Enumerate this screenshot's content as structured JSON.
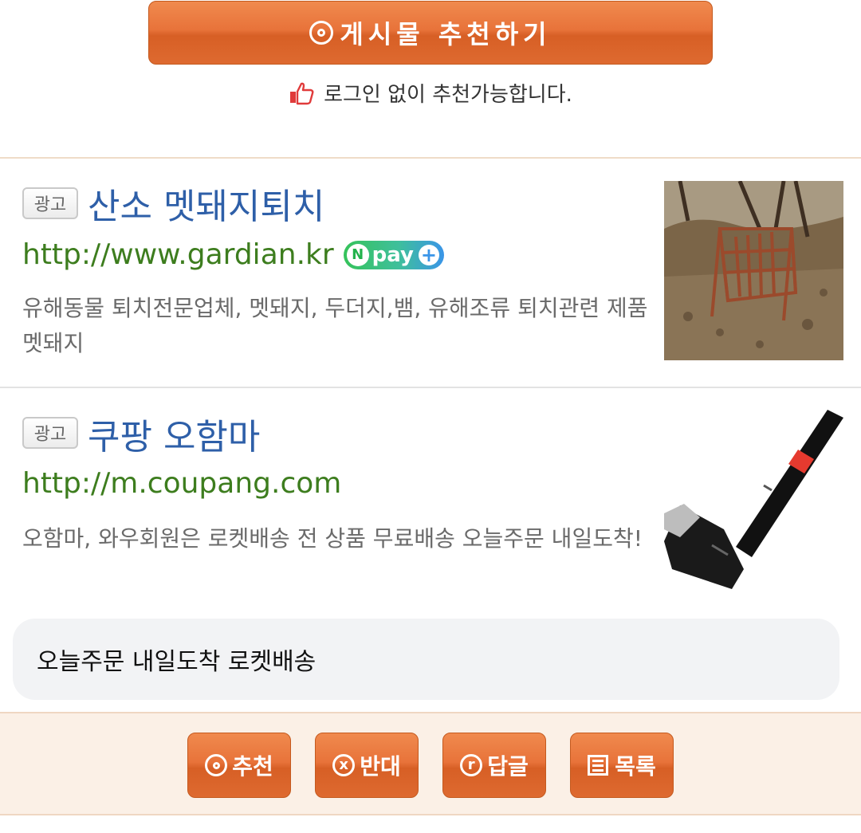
{
  "recommend": {
    "button_label": "게시물 추천하기",
    "note": "로그인 없이 추천가능합니다."
  },
  "ads": [
    {
      "badge": "광고",
      "title": "산소 멧돼지퇴치",
      "url": "http://www.gardian.kr",
      "npay": "pay",
      "description": "유해동물 퇴치전문업체, 멧돼지, 두더지,뱀, 유해조류 퇴치관련 제품 멧돼지"
    },
    {
      "badge": "광고",
      "title": "쿠팡 오함마",
      "url": "http://m.coupang.com",
      "description": "오함마, 와우회원은 로켓배송 전 상품 무료배송 오늘주문 내일도착!"
    }
  ],
  "suggestion": "오늘주문 내일도착 로켓배송",
  "actions": {
    "recommend": "추천",
    "oppose": "반대",
    "reply": "답글",
    "list": "목록"
  }
}
